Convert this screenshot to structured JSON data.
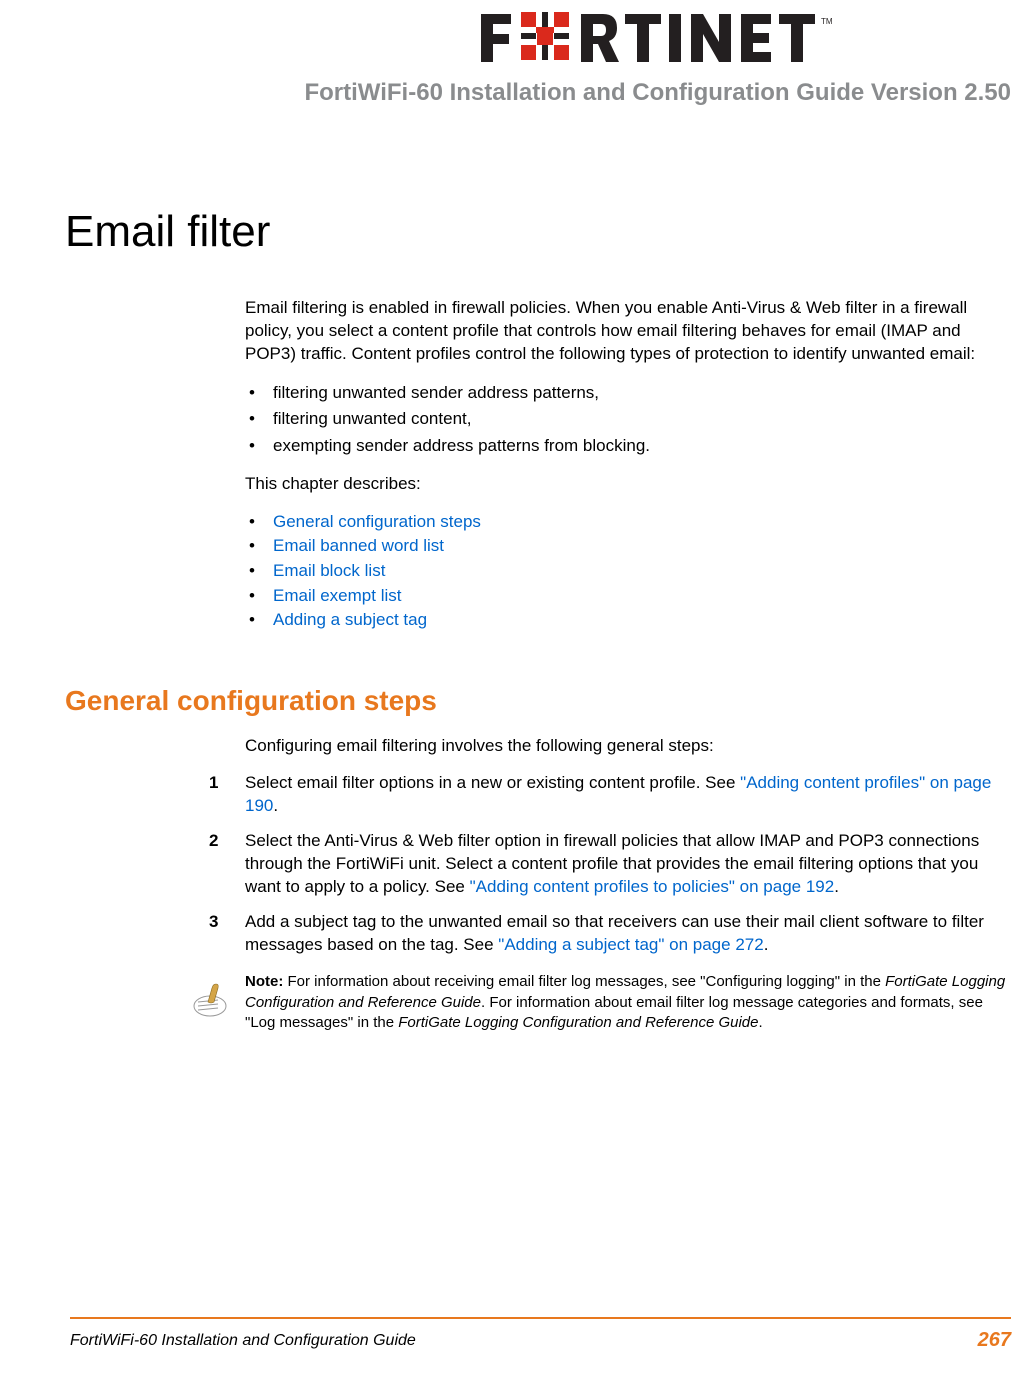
{
  "header": {
    "doc_title": "FortiWiFi-60 Installation and Configuration Guide Version 2.50"
  },
  "chapter": {
    "title": "Email filter"
  },
  "intro": {
    "para1": "Email filtering is enabled in firewall policies. When you enable Anti-Virus & Web filter in a firewall policy, you select a content profile that controls how email filtering behaves for email (IMAP and POP3) traffic. Content profiles control the following types of protection to identify unwanted email:",
    "bullets": [
      "filtering unwanted sender address patterns,",
      "filtering unwanted content,",
      "exempting sender address patterns from blocking."
    ],
    "para2": "This chapter describes:",
    "links": [
      "General configuration steps",
      "Email banned word list",
      "Email block list",
      "Email exempt list",
      "Adding a subject tag"
    ]
  },
  "section": {
    "title": "General configuration steps",
    "para1": "Configuring email filtering involves the following general steps:",
    "steps": [
      {
        "num": "1",
        "text_before": "Select email filter options in a new or existing content profile. See ",
        "link": "\"Adding content profiles\" on page 190",
        "text_after": "."
      },
      {
        "num": "2",
        "text_before": "Select the Anti-Virus & Web filter option in firewall policies that allow IMAP and POP3 connections through the FortiWiFi unit. Select a content profile that provides the email filtering options that you want to apply to a policy. See ",
        "link": "\"Adding content profiles to policies\" on page 192",
        "text_after": "."
      },
      {
        "num": "3",
        "text_before": "Add a subject tag to the unwanted email so that receivers can use their mail client software to filter messages based on the tag. See ",
        "link": "\"Adding a subject tag\" on page 272",
        "text_after": "."
      }
    ]
  },
  "note": {
    "label": "Note:",
    "t1": " For information about receiving email filter log messages, see \"Configuring logging\" in the ",
    "i1": "FortiGate Logging Configuration and Reference Guide",
    "t2": ". For information about email filter log message categories and formats, see \"Log messages\" in the ",
    "i2": "FortiGate Logging Configuration and Reference Guide",
    "t3": "."
  },
  "footer": {
    "title": "FortiWiFi-60 Installation and Configuration Guide",
    "page": "267"
  }
}
